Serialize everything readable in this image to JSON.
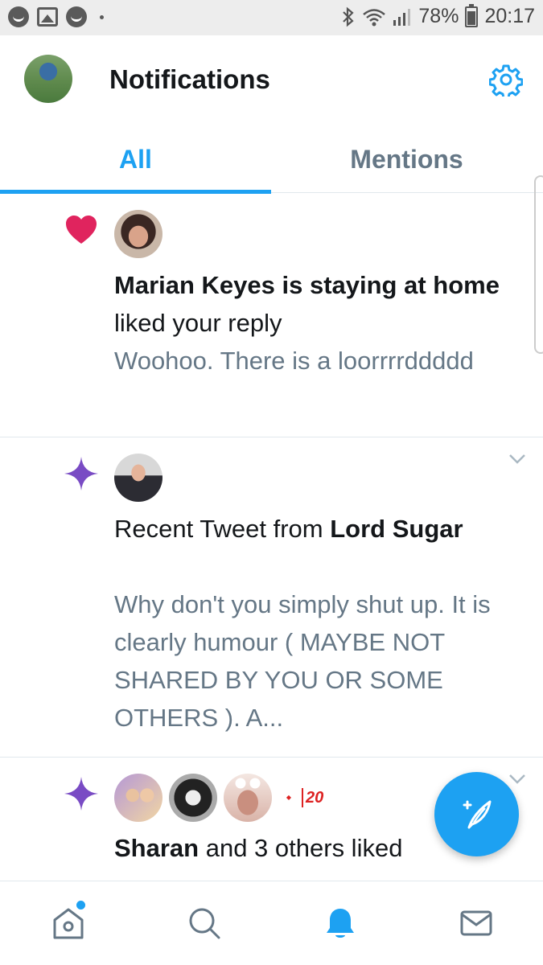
{
  "status_bar": {
    "battery_percent": "78%",
    "time": "20:17",
    "icons": [
      "face-icon",
      "image-icon",
      "face-icon",
      "bluetooth-icon",
      "wifi-icon",
      "signal-icon",
      "battery-icon"
    ]
  },
  "header": {
    "title": "Notifications",
    "settings_icon": "gear-icon"
  },
  "tabs": [
    {
      "label": "All",
      "active": true
    },
    {
      "label": "Mentions",
      "active": false
    }
  ],
  "notifications": [
    {
      "type_icon": "heart-icon",
      "type_color": "#e0245e",
      "actor": "Marian Keyes is staying at home",
      "action": " liked your reply",
      "snippet": "Woohoo. There is a loorrrrddddd"
    },
    {
      "type_icon": "sparkle-icon",
      "type_color": "#794bc4",
      "prefix": "Recent Tweet from ",
      "actor": "Lord Sugar",
      "snippet": "Why don't you simply shut up. It is clearly humour ( MAYBE NOT SHARED BY YOU OR SOME OTHERS ). A..."
    },
    {
      "type_icon": "sparkle-icon",
      "type_color": "#794bc4",
      "actor": "Sharan",
      "action": " and 3 others liked",
      "logo_text": "20"
    }
  ],
  "fab": {
    "icon": "compose-tweet-icon"
  },
  "bottom_nav": [
    {
      "icon": "home-icon",
      "active": false,
      "has_dot": true
    },
    {
      "icon": "search-icon",
      "active": false
    },
    {
      "icon": "bell-icon",
      "active": true
    },
    {
      "icon": "mail-icon",
      "active": false
    }
  ],
  "colors": {
    "accent": "#1da1f2",
    "text": "#14171a",
    "secondary_text": "#657786",
    "divider": "#e1e8ed"
  }
}
